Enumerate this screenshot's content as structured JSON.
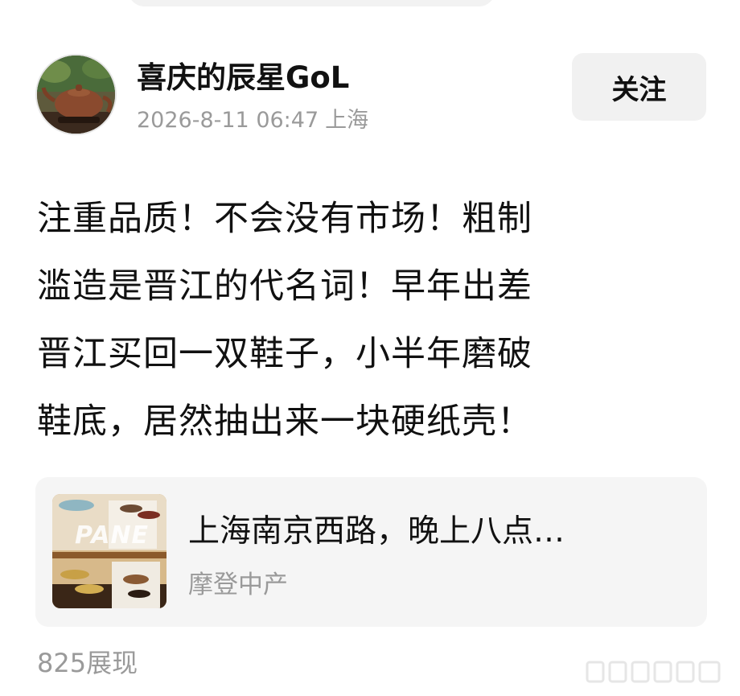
{
  "post": {
    "author": {
      "name": "喜庆的辰星GoL",
      "avatar_icon": "teapot-avatar-icon"
    },
    "meta": {
      "date": "2026-8-11 06:47",
      "location": "上海"
    },
    "follow_label": "关注",
    "body_lines": [
      "注重品质！不会没有市场！粗制",
      "滥造是晋江的代名词！早年出差",
      "晋江买回一双鞋子，小半年磨破",
      "鞋底，居然抽出来一块硬纸壳！"
    ],
    "link_card": {
      "thumb_text": "PANE",
      "title": "上海南京西路，晚上八点…",
      "source": "摩登中产"
    },
    "views_label": "825展现"
  },
  "colors": {
    "text_primary": "#111111",
    "text_secondary": "#9a9a9a",
    "button_bg": "#f1f1f1",
    "card_bg": "#f5f5f5"
  }
}
